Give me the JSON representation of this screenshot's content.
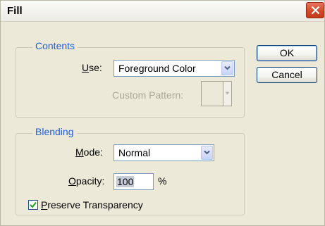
{
  "window": {
    "title": "Fill"
  },
  "contents": {
    "legend": "Contents",
    "use_label_u": "U",
    "use_label_rest": "se:",
    "use_value": "Foreground Color",
    "custom_pattern_label": "Custom Pattern:"
  },
  "blending": {
    "legend": "Blending",
    "mode_label_u": "M",
    "mode_label_rest": "ode:",
    "mode_value": "Normal",
    "opacity_label_u": "O",
    "opacity_label_rest": "pacity:",
    "opacity_value": "100",
    "opacity_unit": "%",
    "preserve_label_u": "P",
    "preserve_label_rest": "reserve Transparency",
    "preserve_checked": true
  },
  "buttons": {
    "ok": "OK",
    "cancel": "Cancel"
  },
  "icons": {
    "close": "close-icon",
    "dropdown": "chevron-down-icon",
    "check": "checkmark-icon"
  },
  "colors": {
    "dialog_bg": "#ece9d8",
    "legend_blue": "#1f5fd6",
    "close_red": "#d24a2a",
    "button_border": "#003c74",
    "disabled_text": "#aca899"
  }
}
